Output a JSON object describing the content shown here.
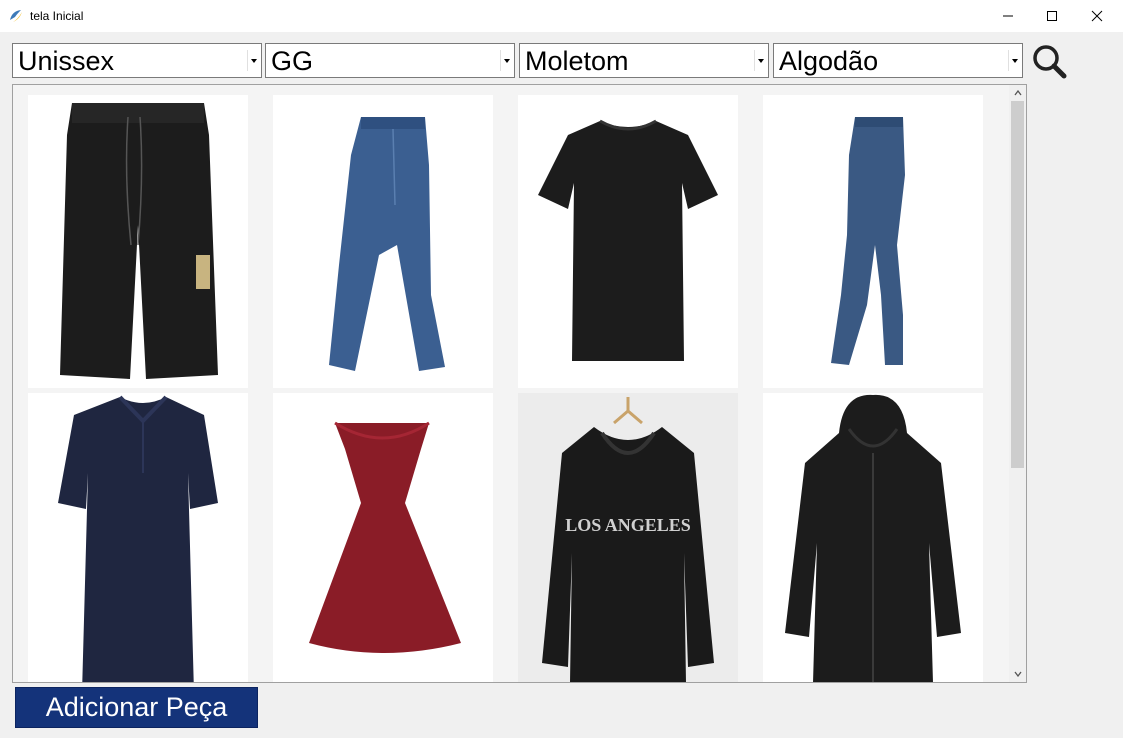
{
  "window": {
    "title": "tela Inicial",
    "icon": "python-feather-icon"
  },
  "filters": [
    {
      "value": "Unissex"
    },
    {
      "value": "GG"
    },
    {
      "value": "Moletom"
    },
    {
      "value": "Algodão"
    }
  ],
  "search": {
    "icon": "magnifier-icon"
  },
  "items": [
    {
      "name": "black-shorts"
    },
    {
      "name": "blue-jeans"
    },
    {
      "name": "black-tshirt"
    },
    {
      "name": "skinny-jeans"
    },
    {
      "name": "navy-polo"
    },
    {
      "name": "red-dress"
    },
    {
      "name": "los-angeles-hoodie",
      "print": "LOS ANGELES"
    },
    {
      "name": "black-zip-hoodie"
    }
  ],
  "actions": {
    "add_label": "Adicionar Peça"
  },
  "colors": {
    "button_bg": "#14337a",
    "garment_black": "#1c1c1c",
    "denim": "#3b5f91",
    "navy": "#1f2640",
    "burgundy": "#8a1c27"
  }
}
